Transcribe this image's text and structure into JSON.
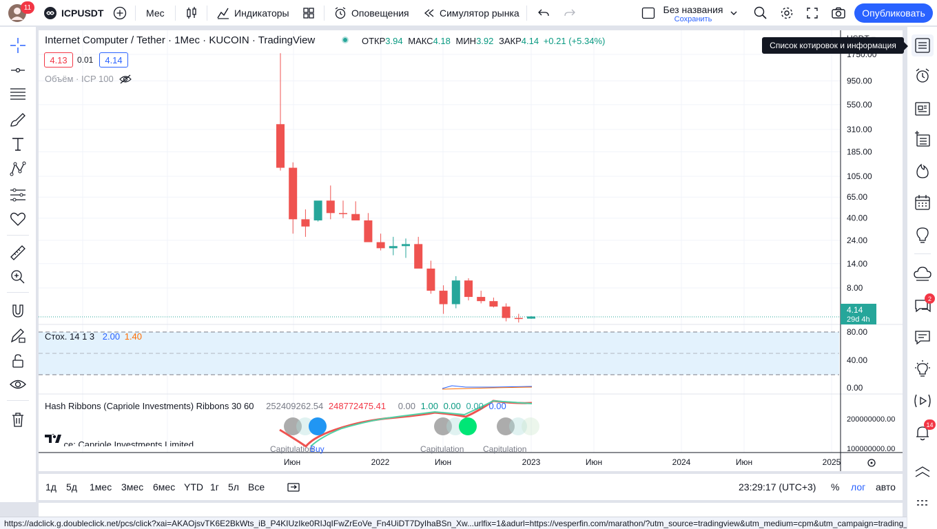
{
  "topbar": {
    "notif_count": "11",
    "symbol": "ICPUSDT",
    "interval": "Мес",
    "indicators": "Индикаторы",
    "alerts": "Оповещения",
    "replay": "Симулятор рынка",
    "layout_name": "Без названия",
    "save": "Сохранить",
    "publish": "Опубликовать"
  },
  "legend": {
    "title": "Internet Computer / Tether · 1Мес · KUCOIN · TradingView",
    "o_label": "ОТКР",
    "o": "3.94",
    "h_label": "МАКС",
    "h": "4.18",
    "l_label": "МИН",
    "l": "3.92",
    "c_label": "ЗАКР",
    "c": "4.14",
    "change": "+0.21 (+5.34%)",
    "bid": "4.13",
    "spread": "0.01",
    "ask": "4.14",
    "volume": "Объём · ICP 100"
  },
  "tooltip": "Список котировок и информация",
  "price_axis": {
    "currency": "USDT ▾",
    "labels": [
      "1750.00",
      "950.00",
      "550.00",
      "310.00",
      "185.00",
      "105.00",
      "65.00",
      "40.00",
      "24.00",
      "14.00",
      "8.00"
    ],
    "last_price": "4.14",
    "countdown": "29d 4h"
  },
  "stoch": {
    "label": "Стох. 14 1 3",
    "k": "2.00",
    "d": "1.40",
    "axis": [
      "80.00",
      "40.00",
      "0.00"
    ]
  },
  "hash": {
    "label": "Hash Ribbons (Capriole Investments) Ribbons 30 60",
    "v1": "252409262.54",
    "v2": "248772475.41",
    "v3": "0.00",
    "v4": "1.00",
    "v5": "0.00",
    "v6": "0.00",
    "v7": "0.00",
    "source": "Source: Capriole Investments Limited",
    "axis": [
      "200000000.00",
      "100000000.00"
    ],
    "marks": [
      "Capitulation",
      "Buy",
      "Capitulation",
      "Capitulation"
    ]
  },
  "time_axis": [
    "Июн",
    "2022",
    "Июн",
    "2023",
    "Июн",
    "2024",
    "Июн",
    "2025"
  ],
  "bottombar": {
    "ranges": [
      "1д",
      "5д",
      "1мес",
      "3мес",
      "6мес",
      "YTD",
      "1г",
      "5л",
      "Все"
    ],
    "clock": "23:29:17 (UTC+3)",
    "pct": "%",
    "log": "лог",
    "auto": "авто"
  },
  "status": "https://adclick.g.doubleclick.net/pcs/click?xai=AKAOjsvTK6E2BkWts_iB_P4KIUzIke0RIJqIFwZrEoVe_Fn4UiDT7DyIhaBSn_Xw...urlfix=1&adurl=https://vesperfin.com/marathon/?utm_source=tradingview&utm_medium=cpm&utm_campaign=trading_txtad",
  "badges": {
    "chat": "2",
    "alerts": "14"
  },
  "chart_data": {
    "type": "candlestick",
    "symbol": "ICPUSDT",
    "exchange": "KUCOIN",
    "interval": "1M",
    "scale": "log",
    "x": [
      "2021-05",
      "2021-06",
      "2021-07",
      "2021-08",
      "2021-09",
      "2021-10",
      "2021-11",
      "2021-12",
      "2022-01",
      "2022-02",
      "2022-03",
      "2022-04",
      "2022-05",
      "2022-06",
      "2022-07",
      "2022-08",
      "2022-09",
      "2022-10",
      "2022-11",
      "2022-12",
      "2023-01"
    ],
    "open": [
      350,
      128,
      39,
      38,
      60,
      45,
      44,
      38,
      23,
      20,
      21,
      22,
      12.5,
      7.5,
      5.5,
      9.5,
      6.5,
      5.9,
      5.2,
      4.0,
      3.94
    ],
    "high": [
      1800,
      145,
      49,
      57,
      85,
      60,
      59,
      45,
      28,
      26,
      25,
      26,
      15,
      8.5,
      10.5,
      10,
      7.5,
      6.4,
      5.6,
      4.4,
      4.18
    ],
    "low": [
      120,
      28,
      26,
      37,
      39,
      40,
      39,
      36,
      19,
      17,
      16,
      21,
      7.0,
      4.4,
      5.0,
      6.0,
      5.6,
      5.1,
      3.7,
      3.6,
      3.92
    ],
    "close": [
      128,
      39,
      33,
      60,
      45,
      44,
      38,
      23,
      20,
      21,
      22,
      12.5,
      7.5,
      5.5,
      9.5,
      6.5,
      5.9,
      5.2,
      4.0,
      3.94,
      4.14
    ]
  }
}
